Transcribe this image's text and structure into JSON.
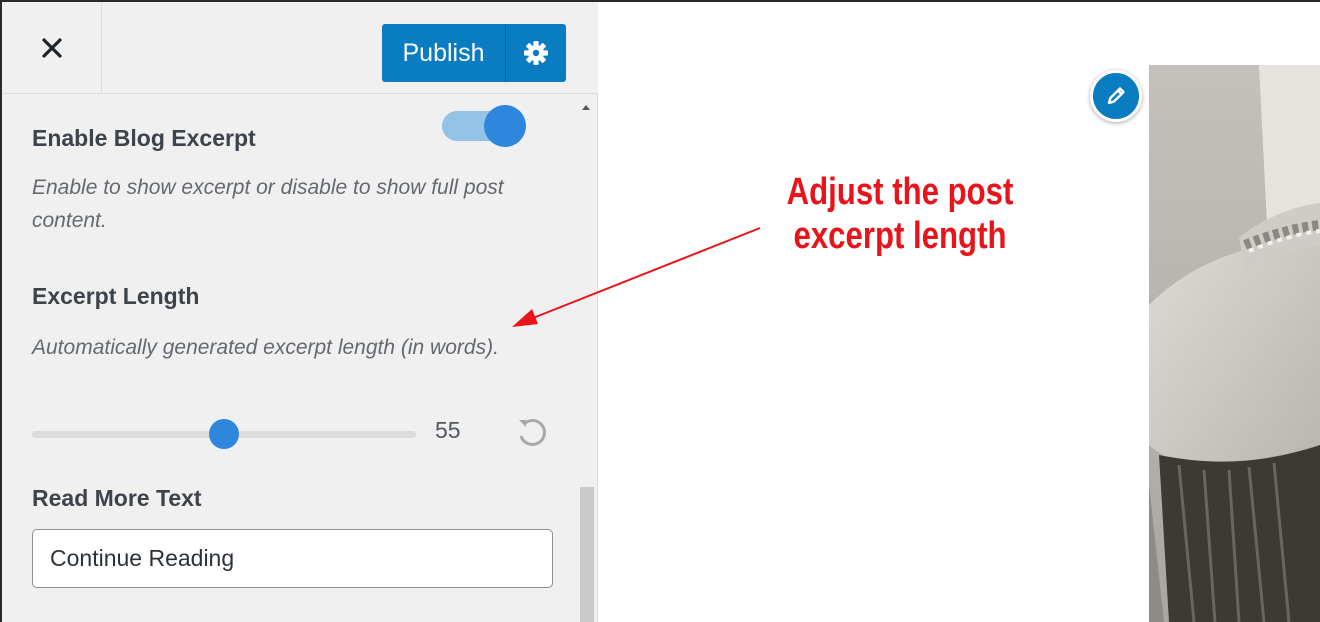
{
  "header": {
    "close_icon": "close-icon",
    "publish_label": "Publish",
    "settings_icon": "gear-icon"
  },
  "sections": {
    "excerpt": {
      "title": "Enable Blog Excerpt",
      "description": "Enable to show excerpt or disable to show full post content.",
      "enabled": true
    },
    "excerpt_length": {
      "title": "Excerpt Length",
      "description": "Automatically generated excerpt length (in words).",
      "value": "55",
      "slider_fraction": 0.5,
      "reset_icon": "reset-icon"
    },
    "read_more": {
      "title": "Read More Text",
      "value": "Continue Reading"
    }
  },
  "preview": {
    "edit_icon": "pencil-icon"
  },
  "annotation": {
    "line1": "Adjust the post",
    "line2": "excerpt length"
  },
  "colors": {
    "accent": "#0a7cc1",
    "toggle_on": "#2e86dd",
    "annotation": "#e8141a"
  }
}
